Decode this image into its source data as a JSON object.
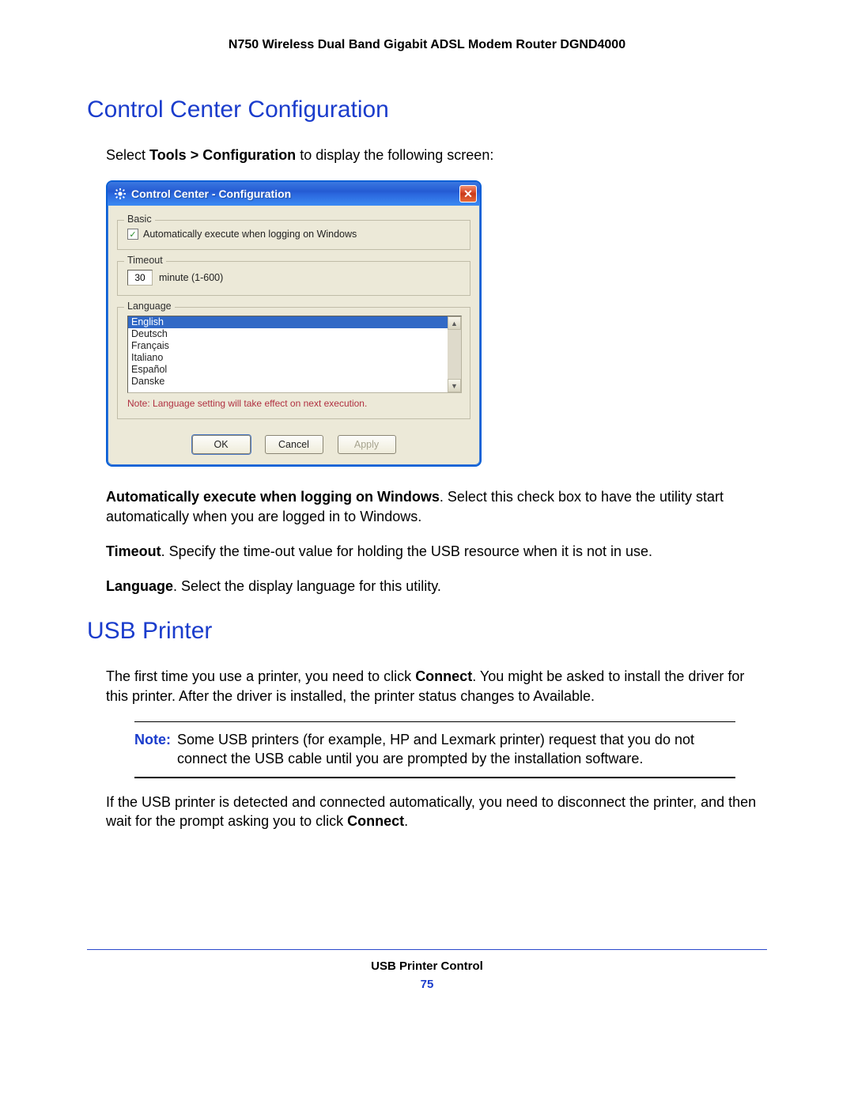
{
  "header": "N750 Wireless Dual Band Gigabit ADSL Modem Router DGND4000",
  "sections": {
    "s1": {
      "title": "Control Center Configuration"
    },
    "s2": {
      "title": "USB Printer"
    }
  },
  "intro1_a": "Select ",
  "intro1_b": "Tools > Configuration",
  "intro1_c": " to display the following screen:",
  "dialog": {
    "title": "Control Center - Configuration",
    "close_x": "✕",
    "groups": {
      "basic": {
        "legend": "Basic",
        "checkbox_checked": true,
        "checkbox_label": "Automatically execute when logging on Windows"
      },
      "timeout": {
        "legend": "Timeout",
        "value": "30",
        "hint": "minute (1-600)"
      },
      "language": {
        "legend": "Language",
        "items": [
          "English",
          "Deutsch",
          "Français",
          "Italiano",
          "Español",
          "Danske"
        ],
        "selected_index": 0,
        "note": "Note: Language setting will take effect on next execution."
      }
    },
    "buttons": {
      "ok": "OK",
      "cancel": "Cancel",
      "apply": "Apply"
    },
    "scroll_up": "▲",
    "scroll_down": "▼",
    "check_glyph": "✓"
  },
  "para_auto_b": "Automatically execute when logging on Windows",
  "para_auto_t": ". Select this check box to have the utility start automatically when you are logged in to Windows.",
  "para_timeout_b": "Timeout",
  "para_timeout_t": ". Specify the time-out value for holding the USB resource when it is not in use.",
  "para_lang_b": "Language",
  "para_lang_t": ". Select the display language for this utility.",
  "para_usb1_a": "The first time you use a printer, you need to click ",
  "para_usb1_b": "Connect",
  "para_usb1_c": ". You might be asked to install the driver for this printer. After the driver is installed, the printer status changes to Available.",
  "note_label": "Note:",
  "note_text": "Some USB printers (for example, HP and Lexmark printer) request that you do not connect the USB cable until you are prompted by the installation software.",
  "para_usb2_a": "If the USB printer is detected and connected automatically, you need to disconnect the printer, and then wait for the prompt asking you to click ",
  "para_usb2_b": "Connect",
  "para_usb2_c": ".",
  "footer": {
    "title": "USB Printer Control",
    "page": "75"
  }
}
